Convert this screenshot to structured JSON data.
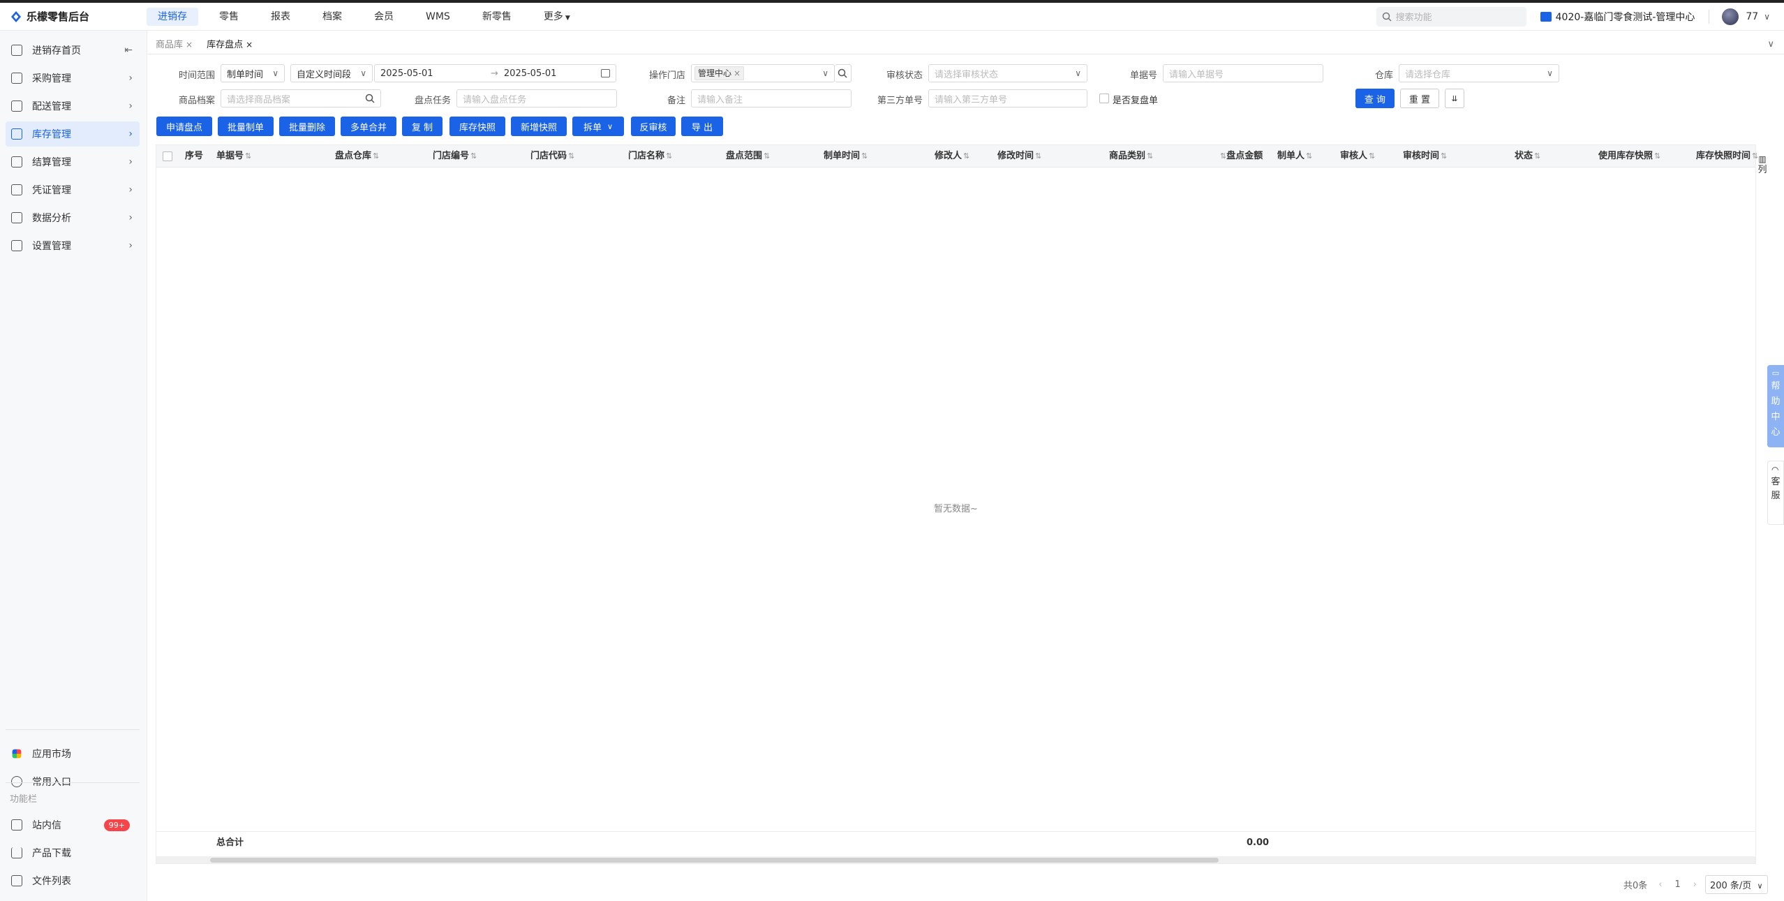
{
  "app": {
    "name": "乐檬零售后台"
  },
  "topnav": [
    {
      "label": "进销存",
      "active": true
    },
    {
      "label": "零售"
    },
    {
      "label": "报表"
    },
    {
      "label": "档案"
    },
    {
      "label": "会员"
    },
    {
      "label": "WMS"
    },
    {
      "label": "新零售"
    },
    {
      "label": "更多"
    }
  ],
  "top": {
    "search_placeholder": "搜索功能",
    "org": "4020-嘉临门零食测试-管理中心",
    "user": "77"
  },
  "sidebar": {
    "items": [
      {
        "label": "进销存首页",
        "icon": "home-icon"
      },
      {
        "label": "采购管理",
        "icon": "cart-icon"
      },
      {
        "label": "配送管理",
        "icon": "box-icon"
      },
      {
        "label": "库存管理",
        "icon": "inventory-icon",
        "active": true
      },
      {
        "label": "结算管理",
        "icon": "money-icon"
      },
      {
        "label": "凭证管理",
        "icon": "voucher-icon"
      },
      {
        "label": "数据分析",
        "icon": "chart-icon"
      },
      {
        "label": "设置管理",
        "icon": "settings-icon"
      }
    ],
    "bottom": [
      {
        "label": "应用市场",
        "icon": "app-market-icon"
      },
      {
        "label": "常用入口",
        "icon": "heart-icon"
      }
    ],
    "section_caption": "功能栏",
    "tools": [
      {
        "label": "站内信",
        "icon": "message-icon",
        "badge": "99+"
      },
      {
        "label": "产品下载",
        "icon": "download-icon"
      },
      {
        "label": "文件列表",
        "icon": "file-list-icon"
      }
    ]
  },
  "tabs": [
    {
      "label": "商品库"
    },
    {
      "label": "库存盘点",
      "active": true
    }
  ],
  "filters": {
    "time_range_label": "时间范围",
    "time_type": "制单时间",
    "time_mode": "自定义时间段",
    "date_start": "2025-05-01",
    "date_sep": "→",
    "date_end": "2025-05-01",
    "store_label": "操作门店",
    "store_tag": "管理中心",
    "audit_label": "审核状态",
    "audit_placeholder": "请选择审核状态",
    "doc_no_label": "单据号",
    "doc_no_placeholder": "请输入单据号",
    "warehouse_label": "仓库",
    "warehouse_placeholder": "请选择仓库",
    "product_label": "商品档案",
    "product_placeholder": "请选择商品档案",
    "task_label": "盘点任务",
    "task_placeholder": "请输入盘点任务",
    "remark_label": "备注",
    "remark_placeholder": "请输入备注",
    "third_label": "第三方单号",
    "third_placeholder": "请输入第三方单号",
    "recheck_label": "是否复盘单",
    "query": "查 询",
    "reset": "重 置"
  },
  "actions": [
    "申请盘点",
    "批量制单",
    "批量删除",
    "多单合并",
    "复 制",
    "库存快照",
    "新增快照",
    "拆单",
    "反审核",
    "导 出"
  ],
  "table": {
    "columns": [
      "序号",
      "单据号",
      "盘点仓库",
      "门店编号",
      "门店代码",
      "门店名称",
      "盘点范围",
      "制单时间",
      "修改人",
      "修改时间",
      "商品类别",
      "盘点金额",
      "制单人",
      "审核人",
      "审核时间",
      "状态",
      "使用库存快照",
      "库存快照时间"
    ],
    "empty_text": "暂无数据~",
    "total_label": "总合计",
    "total_amount": "0.00",
    "column_setting": "列"
  },
  "pager": {
    "total": "共0条",
    "page": "1",
    "page_size": "200 条/页"
  },
  "floating": {
    "help": "帮助中心",
    "service": "客服"
  },
  "colors": {
    "primary": "#1a62e6",
    "badge": "#f5454b",
    "active_bg": "#e3ecfd"
  }
}
